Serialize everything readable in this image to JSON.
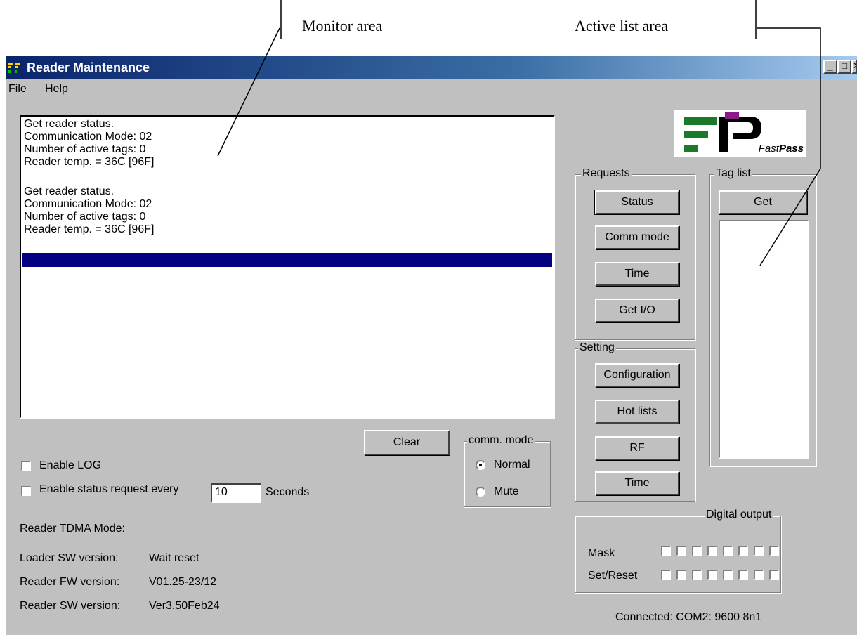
{
  "annotations": {
    "monitor_label": "Monitor area",
    "active_list_label": "Active list area"
  },
  "window": {
    "title": "Reader Maintenance",
    "icon": "fastpass-app-icon",
    "buttons": {
      "minimize": "_",
      "maximize": "□",
      "close": "✕"
    }
  },
  "menu": {
    "file": "File",
    "help": "Help"
  },
  "monitor": {
    "lines": [
      "Get reader status.",
      "Communication Mode: 02",
      "Number of active tags: 0",
      "Reader temp. = 36C [96F]",
      "",
      "Get reader status.",
      "Communication Mode: 02",
      "Number of active tags: 0",
      "Reader temp. = 36C [96F]"
    ]
  },
  "clear_label": "Clear",
  "comm_mode": {
    "title": "comm. mode",
    "normal": "Normal",
    "mute": "Mute",
    "selected": "Normal"
  },
  "options": {
    "enable_log": "Enable LOG",
    "enable_status": "Enable status request every",
    "interval_value": "10",
    "seconds": "Seconds"
  },
  "info": {
    "tdma": "Reader TDMA Mode:",
    "loader_label": "Loader SW version:",
    "loader_value": "Wait reset",
    "fw_label": "Reader FW version:",
    "fw_value": "V01.25-23/12",
    "sw_label": "Reader SW version:",
    "sw_value": "Ver3.50Feb24"
  },
  "logo": {
    "text_a": "Fast",
    "text_b": "Pass",
    "colors": {
      "green": "#1a7a2a",
      "black": "#000000",
      "purple": "#8b1a8b"
    }
  },
  "requests": {
    "title": "Requests",
    "status": "Status",
    "comm_mode": "Comm mode",
    "time": "Time",
    "get_io": "Get I/O"
  },
  "setting": {
    "title": "Setting",
    "configuration": "Configuration",
    "hot_lists": "Hot lists",
    "rf": "RF",
    "time": "Time"
  },
  "taglist": {
    "title": "Tag list",
    "get": "Get"
  },
  "digital_output": {
    "title": "Digital output",
    "mask": "Mask",
    "set_reset": "Set/Reset"
  },
  "status_bar": "Connected: COM2: 9600 8n1",
  "colors": {
    "window_bg": "#c0c0c0",
    "selection": "#000080",
    "title_start": "#0a246a"
  }
}
